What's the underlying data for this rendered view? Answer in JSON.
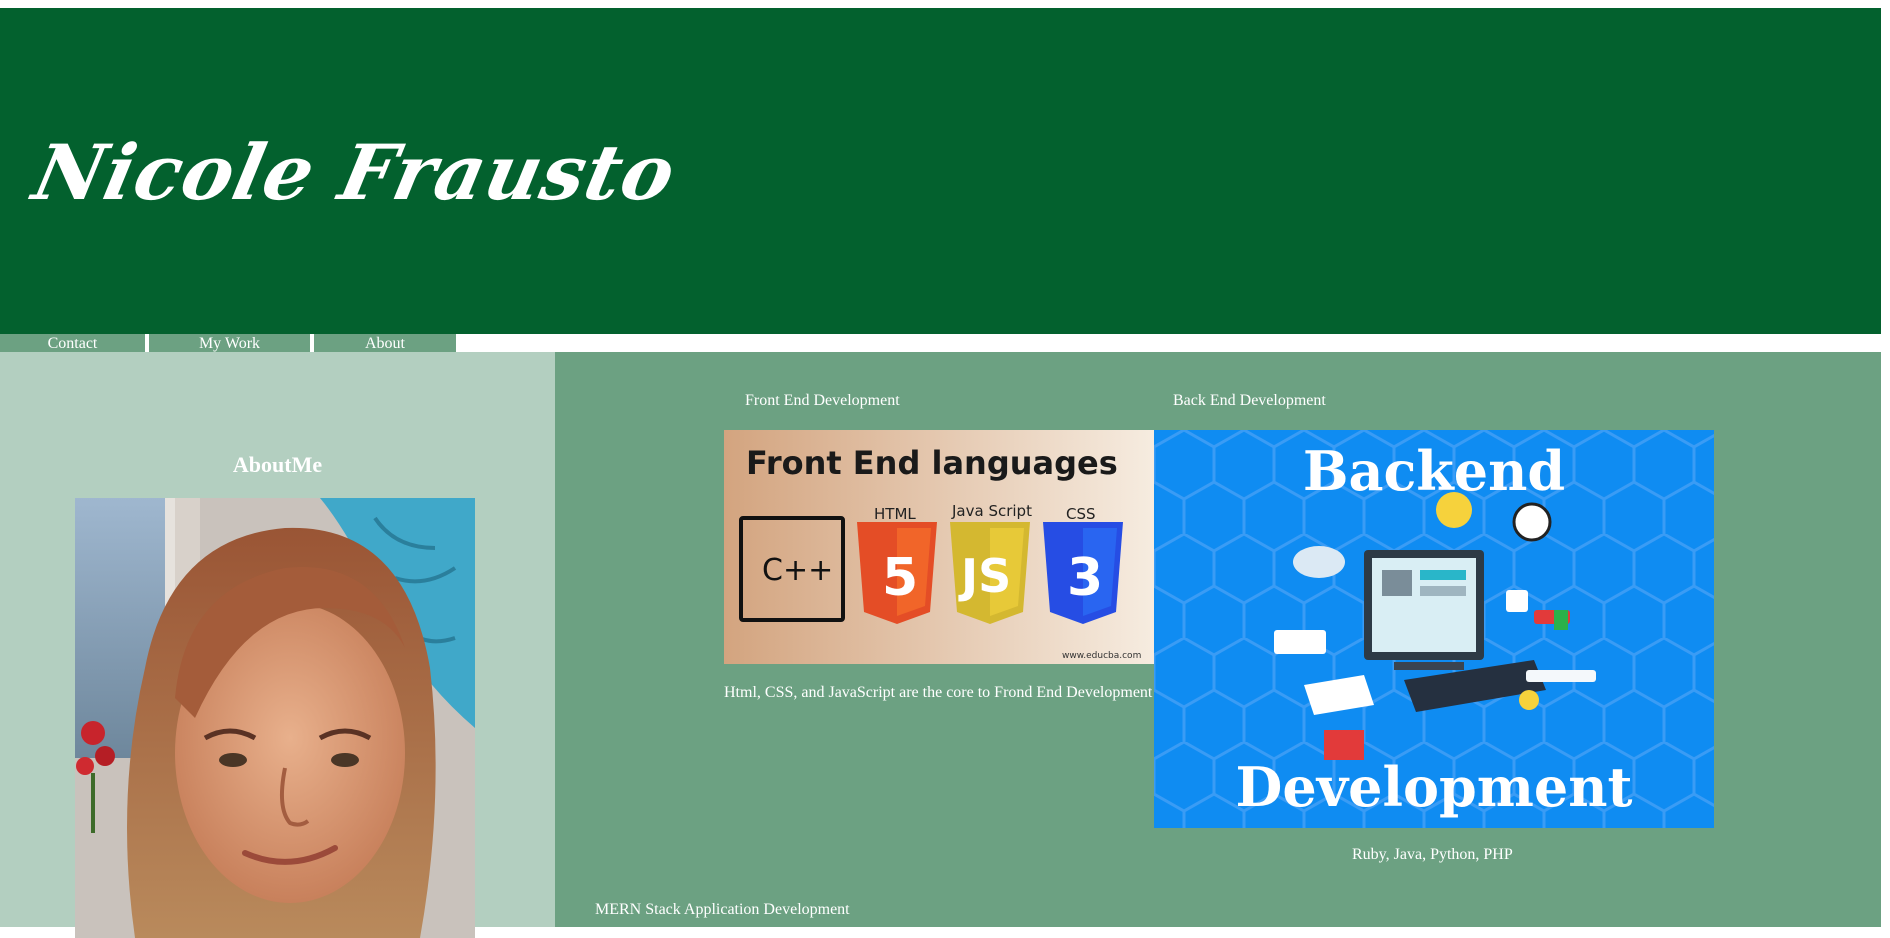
{
  "header": {
    "brand": "Nicole Frausto",
    "background": "#03612e"
  },
  "nav": {
    "items": [
      {
        "label": "Contact"
      },
      {
        "label": "My Work"
      },
      {
        "label": "About"
      }
    ]
  },
  "sidebar": {
    "heading": "AboutMe",
    "background": "#b3cfc0"
  },
  "main": {
    "background": "#6ca182",
    "front_end": {
      "heading": "Front End Development",
      "image_title": "Front End languages",
      "image_labels": [
        "HTML",
        "Java Script",
        "CSS"
      ],
      "image_badges": [
        "C++",
        "5",
        "JS",
        "3"
      ],
      "image_credit": "www.educba.com",
      "caption": "Html, CSS, and JavaScript are the core to Frond End Development"
    },
    "back_end": {
      "heading": "Back End Development",
      "image_title_top": "Backend",
      "image_title_bottom": "Development",
      "caption": "Ruby, Java, Python, PHP"
    },
    "mern": {
      "heading": "MERN Stack Application Development"
    }
  }
}
